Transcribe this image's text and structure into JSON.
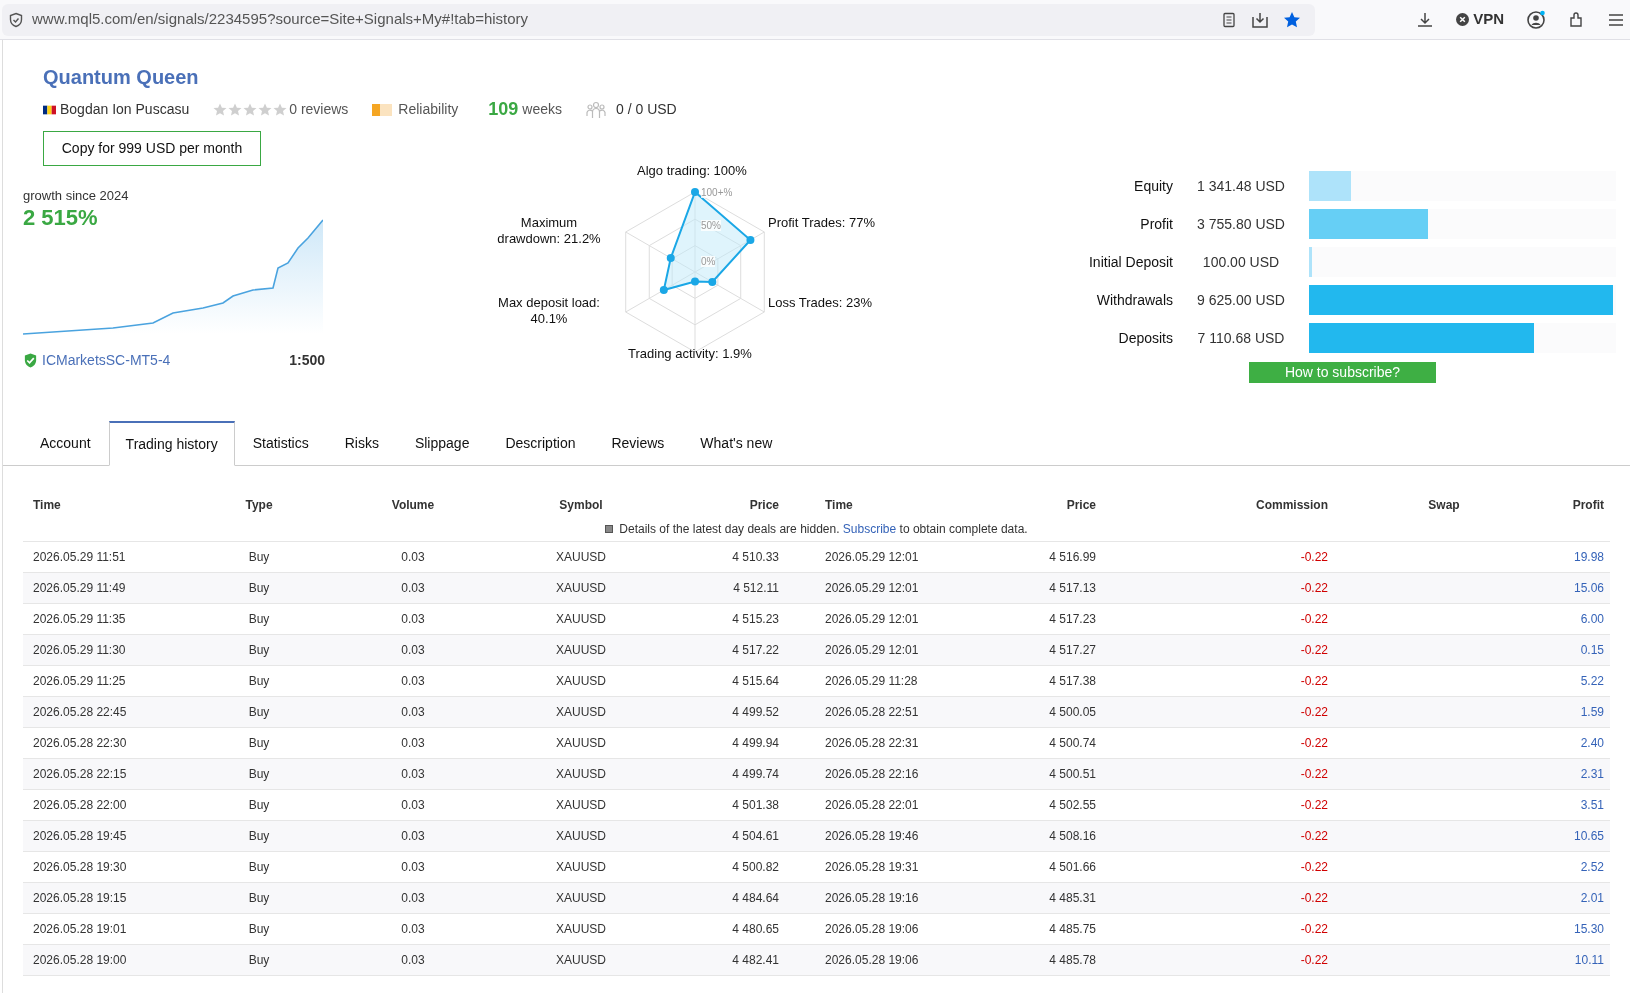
{
  "browser": {
    "url": "www.mql5.com/en/signals/2234595?source=Site+Signals+My#!tab=history",
    "vpn_label": "VPN"
  },
  "signal": {
    "title": "Quantum Queen",
    "author": "Bogdan Ion Puscasu",
    "stars": 0,
    "reviews": "0 reviews",
    "reliability_label": "Reliability",
    "reliability": {
      "level": 0.4
    },
    "weeks_value": "109",
    "weeks_label": "weeks",
    "subscribers": "0 / 0 USD",
    "copy_button": "Copy for 999 USD per month"
  },
  "growth": {
    "label": "growth since 2024",
    "value": "2 515%",
    "server": "ICMarketsSC-MT5-4",
    "leverage": "1:500"
  },
  "radar": {
    "scale": [
      "100+%",
      "50%",
      "0%"
    ],
    "axes": [
      {
        "label": "Algo trading: 100%"
      },
      {
        "label": "Maximum\ndrawdown: 21.2%"
      },
      {
        "label": "Profit Trades: 77%"
      },
      {
        "label": "Max deposit load:\n40.1%"
      },
      {
        "label": "Loss Trades: 23%"
      },
      {
        "label": "Trading activity: 1.9%"
      }
    ]
  },
  "stats": [
    {
      "label": "Equity",
      "value": "1 341.48 USD",
      "level": 0.139,
      "color": "#aee3fa"
    },
    {
      "label": "Profit",
      "value": "3 755.80 USD",
      "level": 0.39,
      "color": "#66cff5"
    },
    {
      "label": "Initial Deposit",
      "value": "100.00 USD",
      "level": 0.0104,
      "color": "#aee3fa"
    },
    {
      "label": "Withdrawals",
      "value": "9 625.00 USD",
      "level": 1,
      "color": "#22b8ee"
    },
    {
      "label": "Deposits",
      "value": "7 110.68 USD",
      "level": 0.739,
      "color": "#22b8ee"
    }
  ],
  "subscribe_button": "How to subscribe?",
  "tabs": [
    {
      "label": "Account",
      "selected": false
    },
    {
      "label": "Trading history",
      "selected": true
    },
    {
      "label": "Statistics",
      "selected": false
    },
    {
      "label": "Risks",
      "selected": false
    },
    {
      "label": "Slippage",
      "selected": false
    },
    {
      "label": "Description",
      "selected": false
    },
    {
      "label": "Reviews",
      "selected": false
    },
    {
      "label": "What's new",
      "selected": false
    }
  ],
  "table": {
    "columns": [
      "Time",
      "Type",
      "Volume",
      "Symbol",
      "Price",
      "Time",
      "Price",
      "Commission",
      "Swap",
      "Profit"
    ],
    "notice": {
      "before": "Details of the latest day deals are hidden. ",
      "link": "Subscribe",
      "after": " to obtain complete data."
    },
    "rows": [
      {
        "open_time": "2026.05.29 11:51",
        "type": "Buy",
        "volume": "0.03",
        "symbol": "XAUUSD",
        "open_price": "4 510.33",
        "close_time": "2026.05.29 12:01",
        "close_price": "4 516.99",
        "commission": "-0.22",
        "profit": "19.98"
      },
      {
        "open_time": "2026.05.29 11:49",
        "type": "Buy",
        "volume": "0.03",
        "symbol": "XAUUSD",
        "open_price": "4 512.11",
        "close_time": "2026.05.29 12:01",
        "close_price": "4 517.13",
        "commission": "-0.22",
        "profit": "15.06"
      },
      {
        "open_time": "2026.05.29 11:35",
        "type": "Buy",
        "volume": "0.03",
        "symbol": "XAUUSD",
        "open_price": "4 515.23",
        "close_time": "2026.05.29 12:01",
        "close_price": "4 517.23",
        "commission": "-0.22",
        "profit": "6.00"
      },
      {
        "open_time": "2026.05.29 11:30",
        "type": "Buy",
        "volume": "0.03",
        "symbol": "XAUUSD",
        "open_price": "4 517.22",
        "close_time": "2026.05.29 12:01",
        "close_price": "4 517.27",
        "commission": "-0.22",
        "profit": "0.15"
      },
      {
        "open_time": "2026.05.29 11:25",
        "type": "Buy",
        "volume": "0.03",
        "symbol": "XAUUSD",
        "open_price": "4 515.64",
        "close_time": "2026.05.29 11:28",
        "close_price": "4 517.38",
        "commission": "-0.22",
        "profit": "5.22"
      },
      {
        "open_time": "2026.05.28 22:45",
        "type": "Buy",
        "volume": "0.03",
        "symbol": "XAUUSD",
        "open_price": "4 499.52",
        "close_time": "2026.05.28 22:51",
        "close_price": "4 500.05",
        "commission": "-0.22",
        "profit": "1.59"
      },
      {
        "open_time": "2026.05.28 22:30",
        "type": "Buy",
        "volume": "0.03",
        "symbol": "XAUUSD",
        "open_price": "4 499.94",
        "close_time": "2026.05.28 22:31",
        "close_price": "4 500.74",
        "commission": "-0.22",
        "profit": "2.40"
      },
      {
        "open_time": "2026.05.28 22:15",
        "type": "Buy",
        "volume": "0.03",
        "symbol": "XAUUSD",
        "open_price": "4 499.74",
        "close_time": "2026.05.28 22:16",
        "close_price": "4 500.51",
        "commission": "-0.22",
        "profit": "2.31"
      },
      {
        "open_time": "2026.05.28 22:00",
        "type": "Buy",
        "volume": "0.03",
        "symbol": "XAUUSD",
        "open_price": "4 501.38",
        "close_time": "2026.05.28 22:01",
        "close_price": "4 502.55",
        "commission": "-0.22",
        "profit": "3.51"
      },
      {
        "open_time": "2026.05.28 19:45",
        "type": "Buy",
        "volume": "0.03",
        "symbol": "XAUUSD",
        "open_price": "4 504.61",
        "close_time": "2026.05.28 19:46",
        "close_price": "4 508.16",
        "commission": "-0.22",
        "profit": "10.65"
      },
      {
        "open_time": "2026.05.28 19:30",
        "type": "Buy",
        "volume": "0.03",
        "symbol": "XAUUSD",
        "open_price": "4 500.82",
        "close_time": "2026.05.28 19:31",
        "close_price": "4 501.66",
        "commission": "-0.22",
        "profit": "2.52"
      },
      {
        "open_time": "2026.05.28 19:15",
        "type": "Buy",
        "volume": "0.03",
        "symbol": "XAUUSD",
        "open_price": "4 484.64",
        "close_time": "2026.05.28 19:16",
        "close_price": "4 485.31",
        "commission": "-0.22",
        "profit": "2.01"
      },
      {
        "open_time": "2026.05.28 19:01",
        "type": "Buy",
        "volume": "0.03",
        "symbol": "XAUUSD",
        "open_price": "4 480.65",
        "close_time": "2026.05.28 19:06",
        "close_price": "4 485.75",
        "commission": "-0.22",
        "profit": "15.30"
      },
      {
        "open_time": "2026.05.28 19:00",
        "type": "Buy",
        "volume": "0.03",
        "symbol": "XAUUSD",
        "open_price": "4 482.41",
        "close_time": "2026.05.28 19:06",
        "close_price": "4 485.78",
        "commission": "-0.22",
        "profit": "10.11"
      }
    ]
  }
}
